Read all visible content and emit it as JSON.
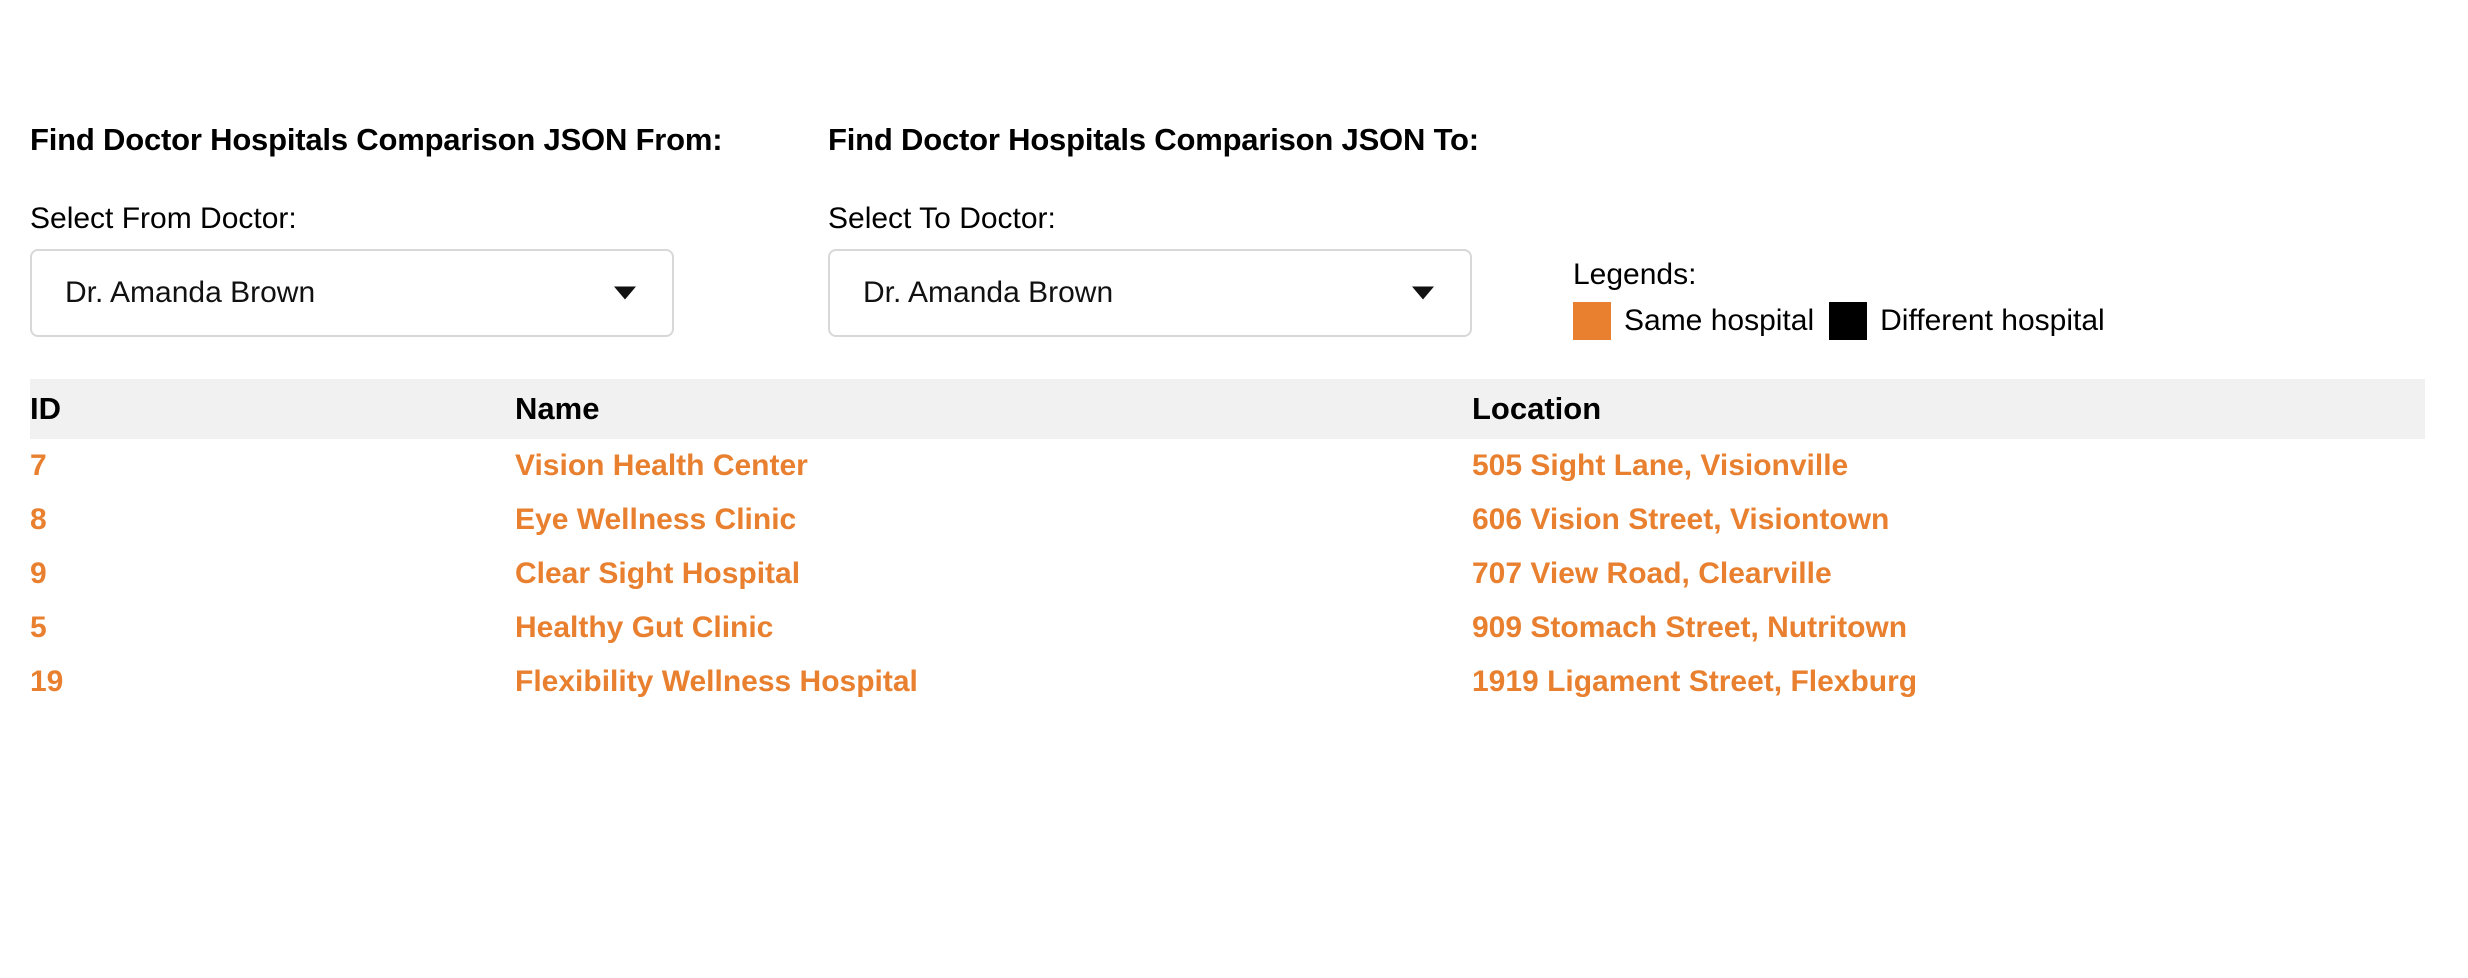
{
  "panels": {
    "from": {
      "heading": "Find Doctor Hospitals Comparison JSON From:",
      "select_label": "Select From Doctor:",
      "selected_value": "Dr. Amanda Brown"
    },
    "to": {
      "heading": "Find Doctor Hospitals Comparison JSON To:",
      "select_label": "Select To Doctor:",
      "selected_value": "Dr. Amanda Brown"
    }
  },
  "legends": {
    "title": "Legends:",
    "items": [
      {
        "label": "Same hospital",
        "color": "#e8802f"
      },
      {
        "label": "Different hospital",
        "color": "#000000"
      }
    ]
  },
  "table": {
    "headers": {
      "id": "ID",
      "name": "Name",
      "location": "Location"
    },
    "rows": [
      {
        "id": "7",
        "name": "Vision Health Center",
        "location": "505 Sight Lane, Visionville",
        "color": "#e8802f"
      },
      {
        "id": "8",
        "name": "Eye Wellness Clinic",
        "location": "606 Vision Street, Visiontown",
        "color": "#e8802f"
      },
      {
        "id": "9",
        "name": "Clear Sight Hospital",
        "location": "707 View Road, Clearville",
        "color": "#e8802f"
      },
      {
        "id": "5",
        "name": "Healthy Gut Clinic",
        "location": "909 Stomach Street, Nutritown",
        "color": "#e8802f"
      },
      {
        "id": "19",
        "name": "Flexibility Wellness Hospital",
        "location": "1919 Ligament Street, Flexburg",
        "color": "#e8802f"
      }
    ]
  },
  "colors": {
    "same_hospital": "#e8802f",
    "different_hospital": "#000000",
    "header_background": "#f1f1f1",
    "select_border": "#d8d8d8"
  }
}
